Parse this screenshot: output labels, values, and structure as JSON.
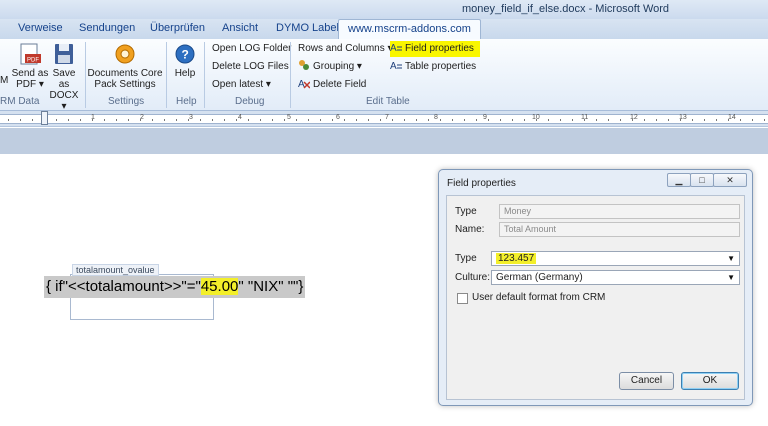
{
  "window": {
    "title": "money_field_if_else.docx - Microsoft Word"
  },
  "tabs": [
    "Verweise",
    "Sendungen",
    "Überprüfen",
    "Ansicht",
    "DYMO Label",
    "www.mscrm-addons.com"
  ],
  "ribbon": {
    "crm_data": {
      "btn_m": "M",
      "send_pdf": "Send as",
      "send_pdf_2": "PDF ▾",
      "save_docx": "Save as",
      "save_docx_2": "DOCX ▾",
      "label": "RM Data"
    },
    "settings": {
      "documents_core": "Documents Core",
      "pack_settings": "Pack Settings",
      "label": "Settings"
    },
    "help": {
      "button": "Help",
      "label": "Help"
    },
    "debug": {
      "open_log_folder": "Open LOG Folder",
      "delete_log_files": "Delete LOG Files",
      "open_latest": "Open latest ▾",
      "label": "Debug"
    },
    "edit_table": {
      "rows_columns": "Rows and Columns ▾",
      "grouping": "Grouping ▾",
      "delete_field": "Delete Field",
      "field_properties": "Field properties",
      "table_properties": "Table properties",
      "label": "Edit Table"
    }
  },
  "ruler": {
    "numbers": [
      "1",
      "2",
      "3",
      "4",
      "5",
      "6",
      "7",
      "8",
      "9",
      "10",
      "11",
      "12",
      "13",
      "14"
    ]
  },
  "document": {
    "field_tag": "totalamount_ovalue",
    "code_before": "{ if\"<<totalamount>>\"=\"",
    "code_highlight": "45.00",
    "code_after": "\" \"NIX\" \"\"}"
  },
  "dialog": {
    "title": "Field properties",
    "type_label": "Type",
    "type_value": "Money",
    "name_label": "Name:",
    "name_value": "Total Amount",
    "format_type_label": "Type",
    "format_type_value": "123.457",
    "culture_label": "Culture:",
    "culture_value": "German (Germany)",
    "checkbox_label": "User default format from CRM",
    "cancel": "Cancel",
    "ok": "OK"
  },
  "colors": {
    "highlight": "#f3ef2a",
    "ribbon_highlight": "#f9f600",
    "tab_text": "#15428b"
  }
}
